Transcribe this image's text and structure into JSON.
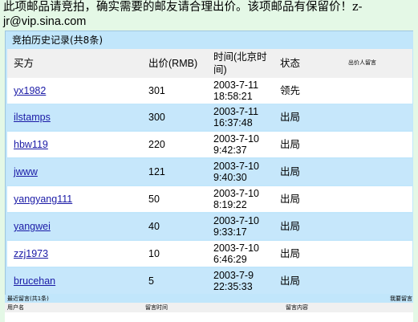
{
  "notice": {
    "line1": "此项邮品请竞拍，确实需要的邮友请合理出价。该项邮品有保留价！z-",
    "line2": "jr@vip.sina.com"
  },
  "history": {
    "title": "竞拍历史记录(共8条)",
    "columns": {
      "bidder": "买方",
      "price": "出价(RMB)",
      "time_line1": "时间(北京时",
      "time_line2": "间)",
      "status": "状态",
      "message": "出价人留言"
    },
    "rows": [
      {
        "bidder": "yx1982",
        "price": "301",
        "date": "2003-7-11",
        "clock": "18:58:21",
        "status": "领先"
      },
      {
        "bidder": "ilstamps",
        "price": "300",
        "date": "2003-7-11",
        "clock": "16:37:48",
        "status": "出局"
      },
      {
        "bidder": "hbw119",
        "price": "220",
        "date": "2003-7-10",
        "clock": "9:42:37",
        "status": "出局"
      },
      {
        "bidder": "jwww",
        "price": "121",
        "date": "2003-7-10",
        "clock": "9:40:30",
        "status": "出局"
      },
      {
        "bidder": "yangyang111",
        "price": "50",
        "date": "2003-7-10",
        "clock": "8:19:22",
        "status": "出局"
      },
      {
        "bidder": "yangwei",
        "price": "40",
        "date": "2003-7-10",
        "clock": "9:33:17",
        "status": "出局"
      },
      {
        "bidder": "zzj1973",
        "price": "10",
        "date": "2003-7-10",
        "clock": "6:46:29",
        "status": "出局"
      },
      {
        "bidder": "brucehan",
        "price": "5",
        "date": "2003-7-9",
        "clock": "22:35:33",
        "status": "出局"
      }
    ]
  },
  "comments": {
    "title": "最近留言(共1条)",
    "post_link": "我要留言",
    "columns": {
      "user": "用户名",
      "time": "留言时间",
      "content": "留言内容"
    }
  }
}
